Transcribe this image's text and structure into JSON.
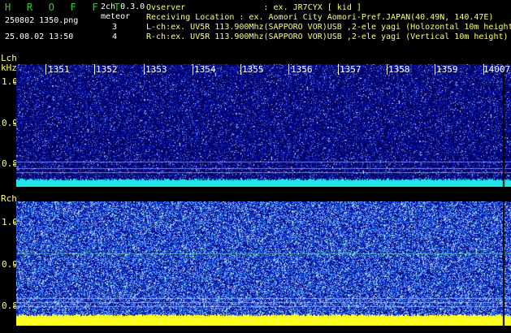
{
  "header": {
    "brand": "H R O F F T",
    "mode": "2ch 0.3.0",
    "filename": "250802 1350.png",
    "event_label": "meteor",
    "count_l": "3",
    "count_r": "4",
    "datetime": "25.08.02 13:50",
    "observer": "Ovserver                : ex. JR7CYX [ kid ]",
    "location": "Receiving Location : ex. Aomori City Aomori-Pref.JAPAN(40.49N, 140.47E)",
    "lch_info": "L-ch:ex. UV5R 113.900Mhz(SAPPORO VOR)USB ,2-ele yagi (Holozontal 10m height)",
    "rch_info": "R-ch:ex. UV5R 113.900Mhz(SAPPORO VOR)USB ,2-ele yagi (Vertical 10m height)"
  },
  "spectrogram": {
    "lch_title": "Lch",
    "unit": "kHz",
    "rch_title": "Rch",
    "y_labels": [
      "1.0",
      "0.9",
      "0.8"
    ],
    "time_labels": [
      "1351",
      "1352",
      "1353",
      "1354",
      "1355",
      "1356",
      "1357",
      "1358",
      "1359",
      "14007"
    ]
  }
}
